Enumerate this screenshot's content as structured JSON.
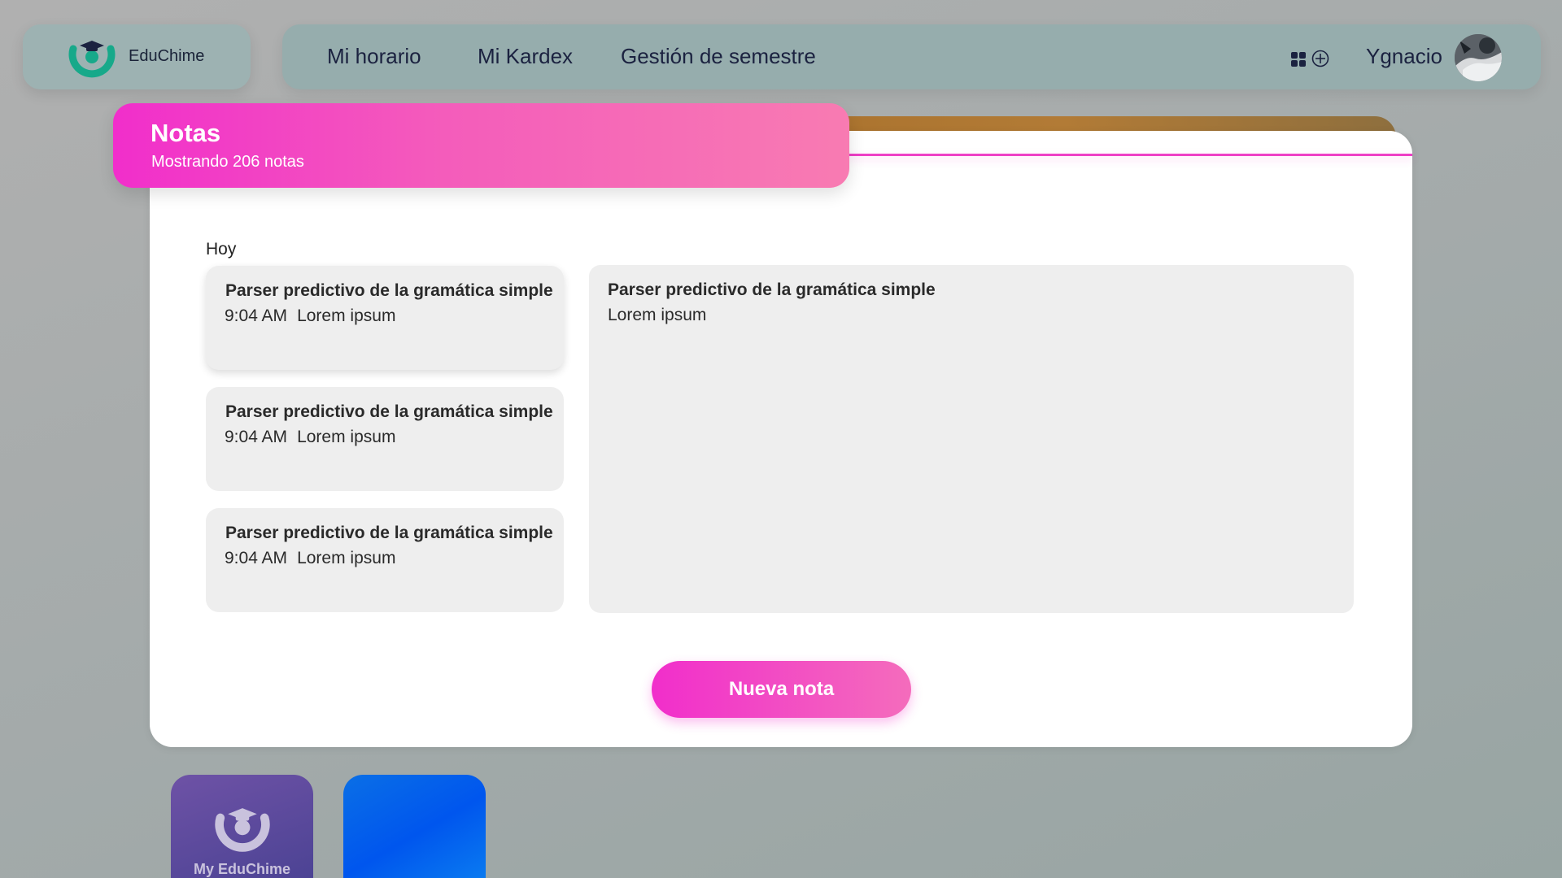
{
  "brand": {
    "name": "EduChime",
    "logo_icon": "graduation-cap-logo-icon",
    "colors": {
      "logo": "#17a98a",
      "cap": "#1b2240"
    }
  },
  "nav": {
    "links": [
      {
        "label": "Mi horario"
      },
      {
        "label": "Mi Kardex"
      },
      {
        "label": "Gestión de semestre"
      }
    ],
    "icons": [
      "apps-grid-icon",
      "add-circle-icon"
    ],
    "user": {
      "name": "Ygnacio"
    }
  },
  "notes": {
    "title": "Notas",
    "subtitle": "Mostrando 206 notas",
    "section_label": "Hoy",
    "items": [
      {
        "title": "Parser predictivo de la gramática simple",
        "time": "9:04 AM",
        "preview": "Lorem ipsum",
        "selected": true
      },
      {
        "title": "Parser predictivo de la gramática simple",
        "time": "9:04 AM",
        "preview": "Lorem ipsum",
        "selected": false
      },
      {
        "title": "Parser predictivo de la gramática simple",
        "time": "9:04 AM",
        "preview": "Lorem ipsum",
        "selected": false
      }
    ],
    "detail": {
      "title": "Parser predictivo de la gramática simple",
      "body": "Lorem ipsum"
    },
    "new_button_label": "Nueva nota",
    "accent_color": "#f12ecb"
  },
  "dock": {
    "apps": [
      {
        "label": "My EduChime",
        "icon": "graduation-cap-logo-icon"
      },
      {
        "label": "",
        "icon": ""
      }
    ]
  }
}
